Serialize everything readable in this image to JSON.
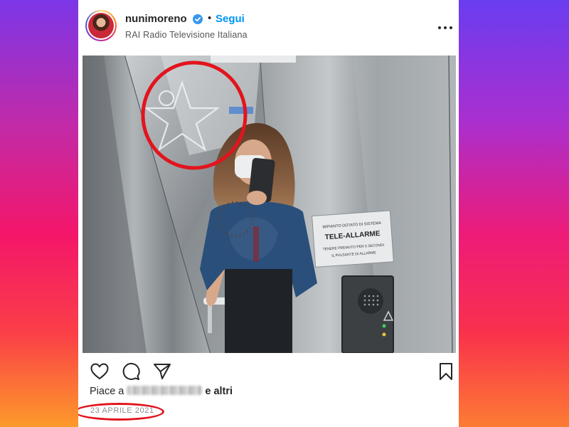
{
  "post": {
    "username": "nunimoreno",
    "follow_label": "Segui",
    "separator": "•",
    "location": "RAI Radio Televisione Italiana",
    "image_sign": {
      "line1": "IMPIANTO DOTATO DI SISTEMA",
      "line2": "TELE-ALLARME",
      "line3": "TENERE PREMUTO PER 5 SECONDI",
      "line4": "IL PULSANTE DI ALLARME"
    },
    "likes_prefix": "Piace a",
    "likes_suffix": "e altri",
    "date": "23 APRILE 2021"
  },
  "colors": {
    "accent_blue": "#0095f6",
    "highlight_red": "#e2141d",
    "text_dark": "#262626"
  },
  "icons": [
    "verified-badge-icon",
    "more-options-icon",
    "heart-icon",
    "comment-icon",
    "share-icon",
    "bookmark-icon"
  ]
}
